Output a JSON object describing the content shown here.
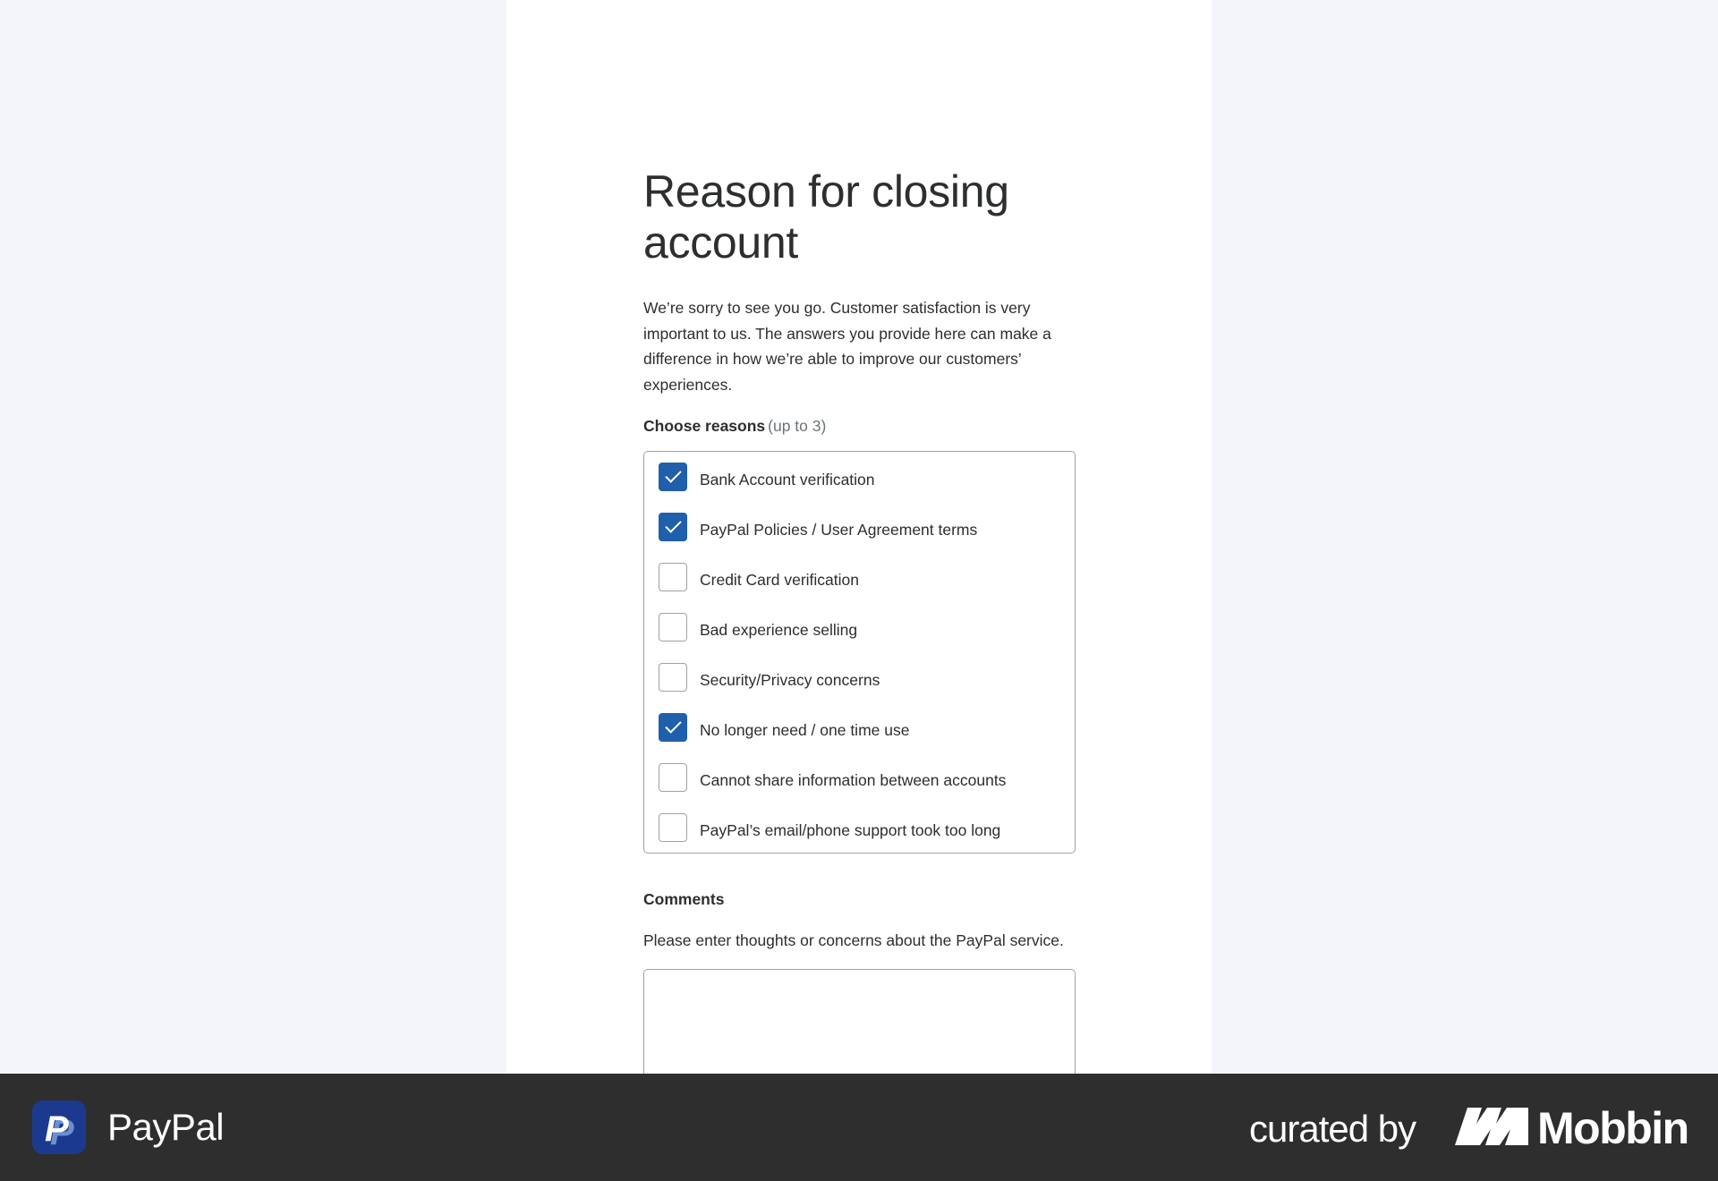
{
  "modal": {
    "title": "Reason for closing account",
    "intro": "We’re sorry to see you go. Customer satisfaction is very important to us. The answers you provide here can make a difference in how we’re able to improve our customers’ experiences.",
    "choose_label": "Choose reasons",
    "choose_hint": "(up to 3)",
    "reasons": [
      {
        "label": "Bank Account verification",
        "checked": true
      },
      {
        "label": "PayPal Policies / User Agreement terms",
        "checked": true
      },
      {
        "label": "Credit Card verification",
        "checked": false
      },
      {
        "label": "Bad experience selling",
        "checked": false
      },
      {
        "label": "Security/Privacy concerns",
        "checked": false
      },
      {
        "label": "No longer need / one time use",
        "checked": true
      },
      {
        "label": "Cannot share information between accounts",
        "checked": false
      },
      {
        "label": "PayPal’s email/phone support took too long",
        "checked": false
      }
    ],
    "comments_label": "Comments",
    "comments_hint": "Please enter thoughts or concerns about the PayPal service.",
    "comments_value": ""
  },
  "footer": {
    "brand_name": "PayPal",
    "curated_by": "curated by",
    "curator": "Mobbin"
  },
  "colors": {
    "accent": "#1f5fab",
    "footer_bg": "#2e2e2e",
    "page_bg": "#f3f5f9"
  }
}
